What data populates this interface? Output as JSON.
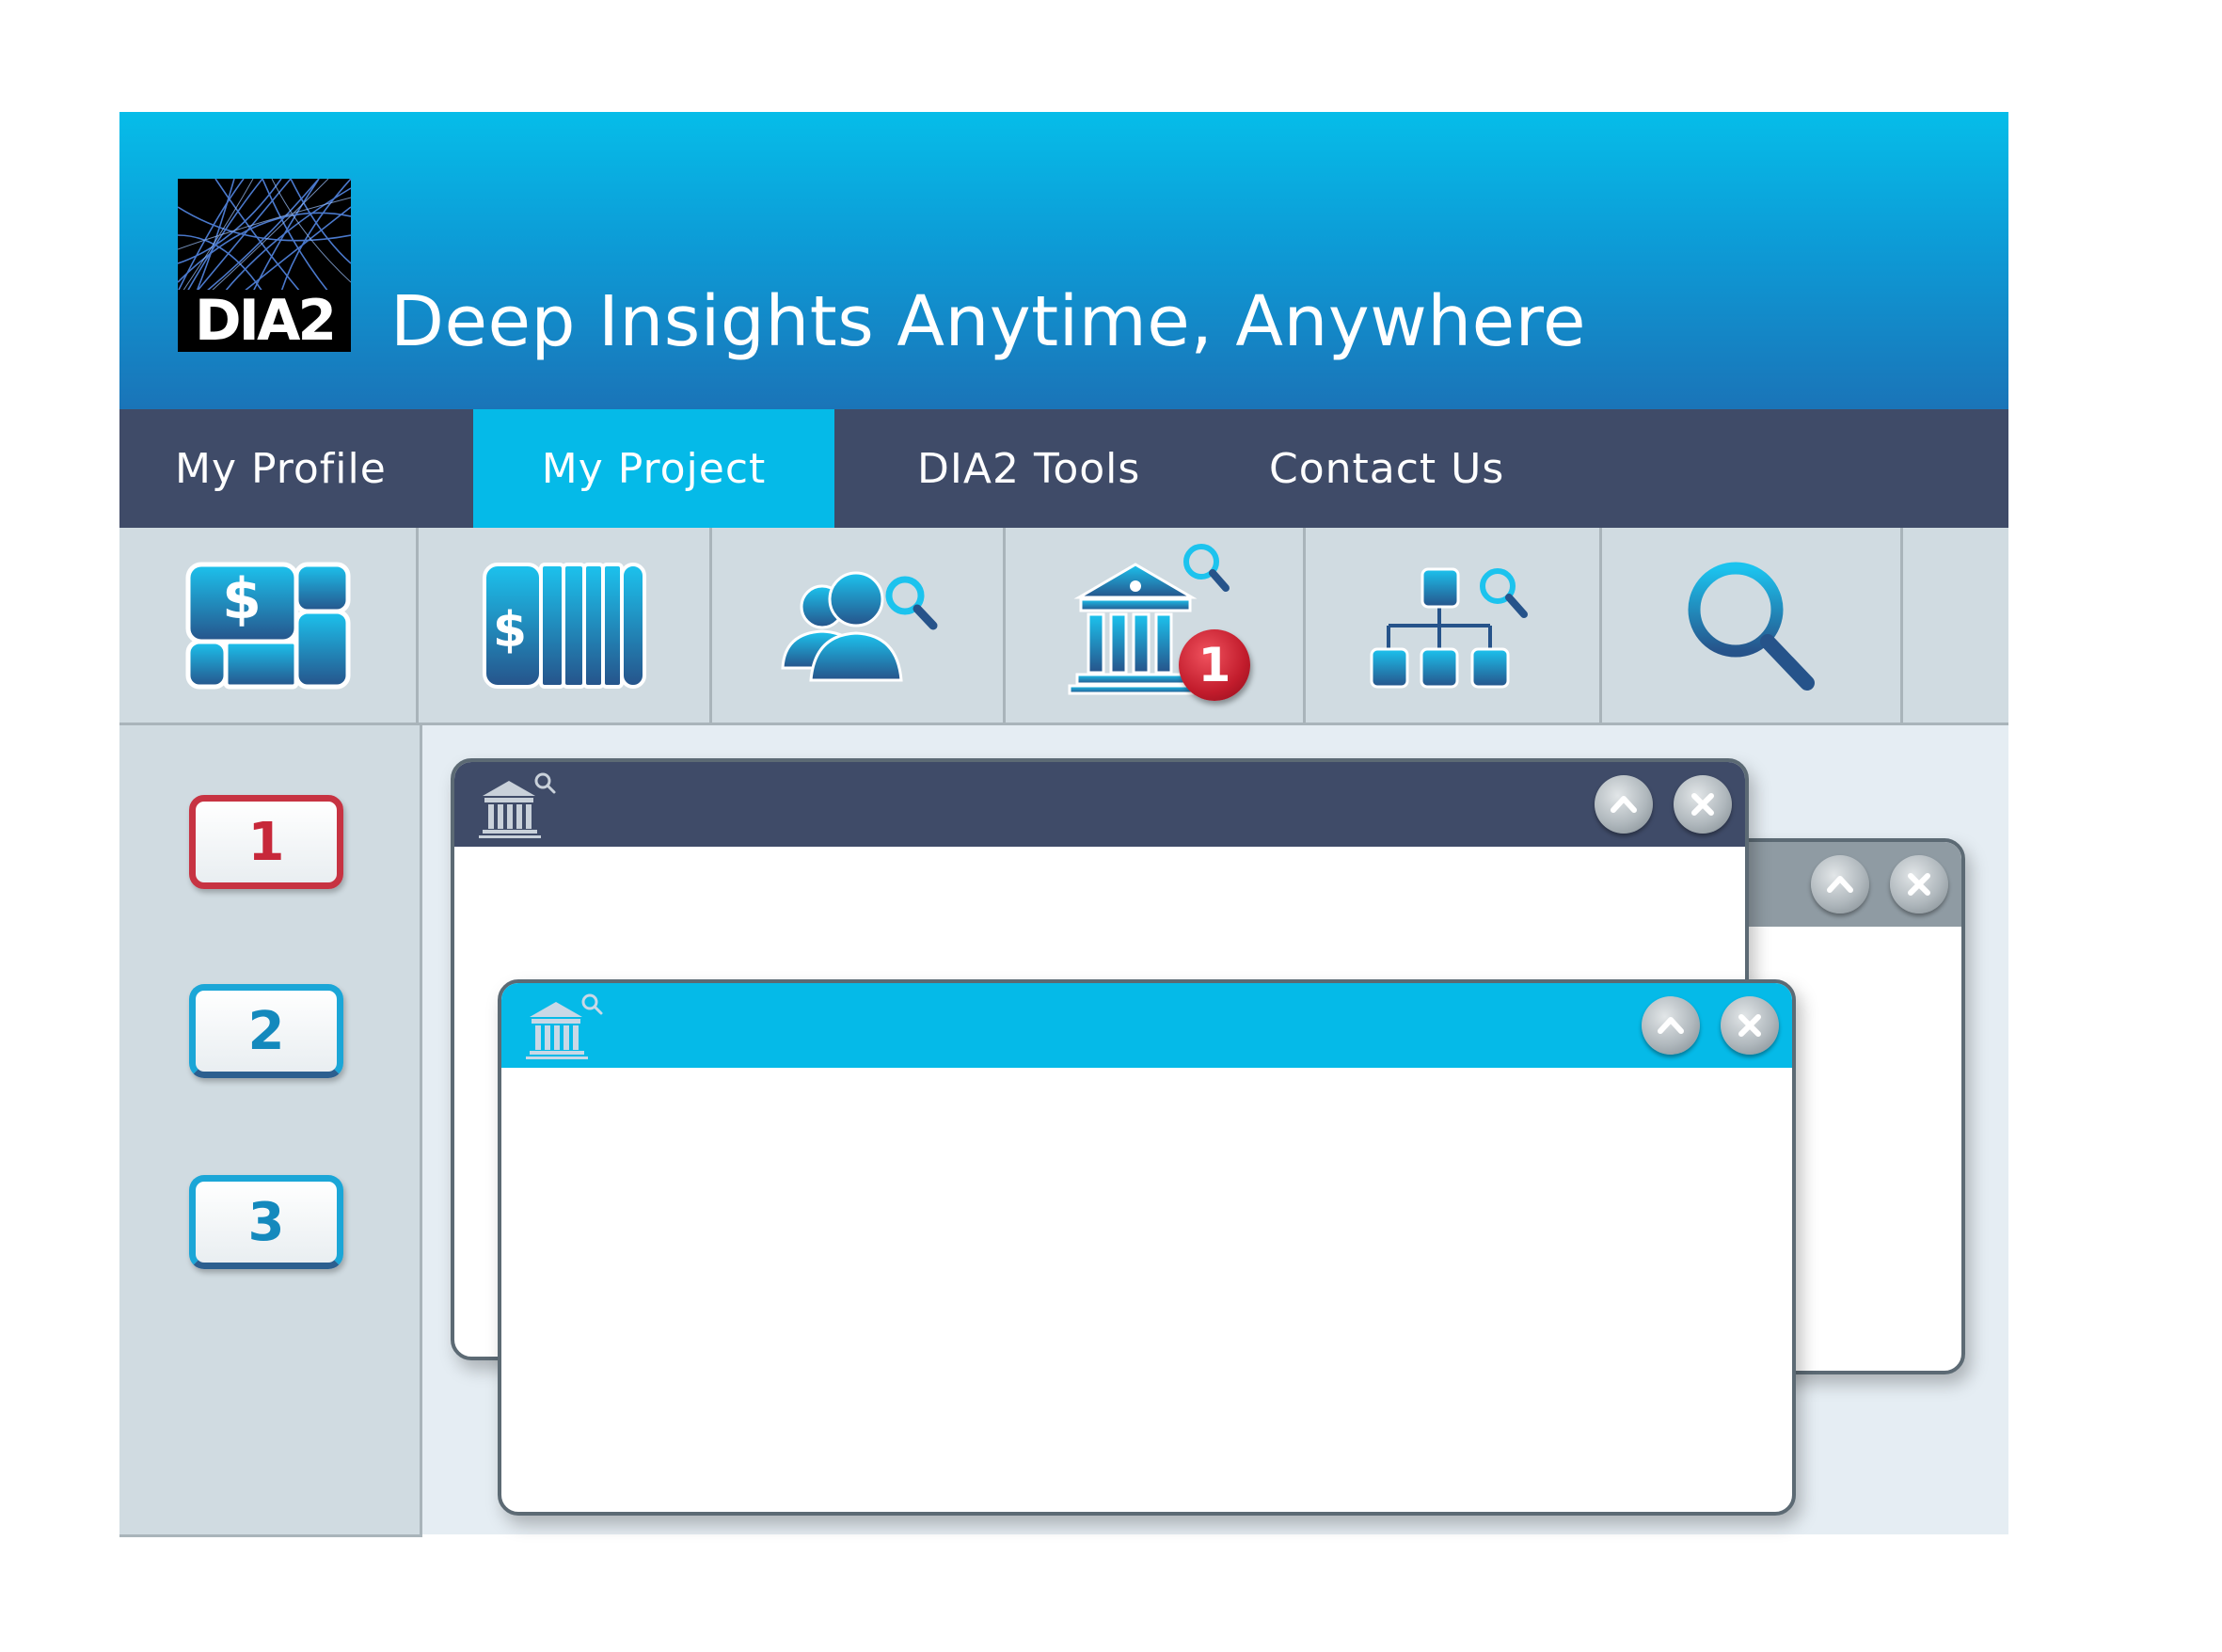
{
  "header": {
    "logo_text": "DIA2",
    "tagline": "Deep Insights Anytime, Anywhere"
  },
  "nav": {
    "items": [
      {
        "label": "My Profile",
        "active": false
      },
      {
        "label": "My Project",
        "active": true
      },
      {
        "label": "DIA2 Tools",
        "active": false
      },
      {
        "label": "Contact Us",
        "active": false
      }
    ]
  },
  "toolbar": {
    "tools": [
      {
        "icon": "funding-grid-icon",
        "glyph": "$"
      },
      {
        "icon": "funding-columns-icon",
        "glyph": "$"
      },
      {
        "icon": "people-search-icon"
      },
      {
        "icon": "institution-search-icon",
        "badge": "1"
      },
      {
        "icon": "org-chart-search-icon"
      },
      {
        "icon": "search-icon"
      }
    ]
  },
  "sidebar": {
    "buttons": [
      {
        "label": "1",
        "style": "red"
      },
      {
        "label": "2",
        "style": "blue"
      },
      {
        "label": "3",
        "style": "blue"
      }
    ]
  },
  "windows": [
    {
      "name": "back",
      "bar_color": "#8f9ba3"
    },
    {
      "name": "middle",
      "bar_color": "#3f4b68",
      "icon": "institution-search-icon"
    },
    {
      "name": "front",
      "bar_color": "#05bae8",
      "icon": "institution-search-icon"
    }
  ],
  "colors": {
    "header_top": "#06bde9",
    "header_bottom": "#1a74b8",
    "nav_bg": "#3f4b68",
    "nav_active": "#05bae8",
    "panel_bg": "#d0dbe1",
    "badge_red": "#c7283a"
  }
}
